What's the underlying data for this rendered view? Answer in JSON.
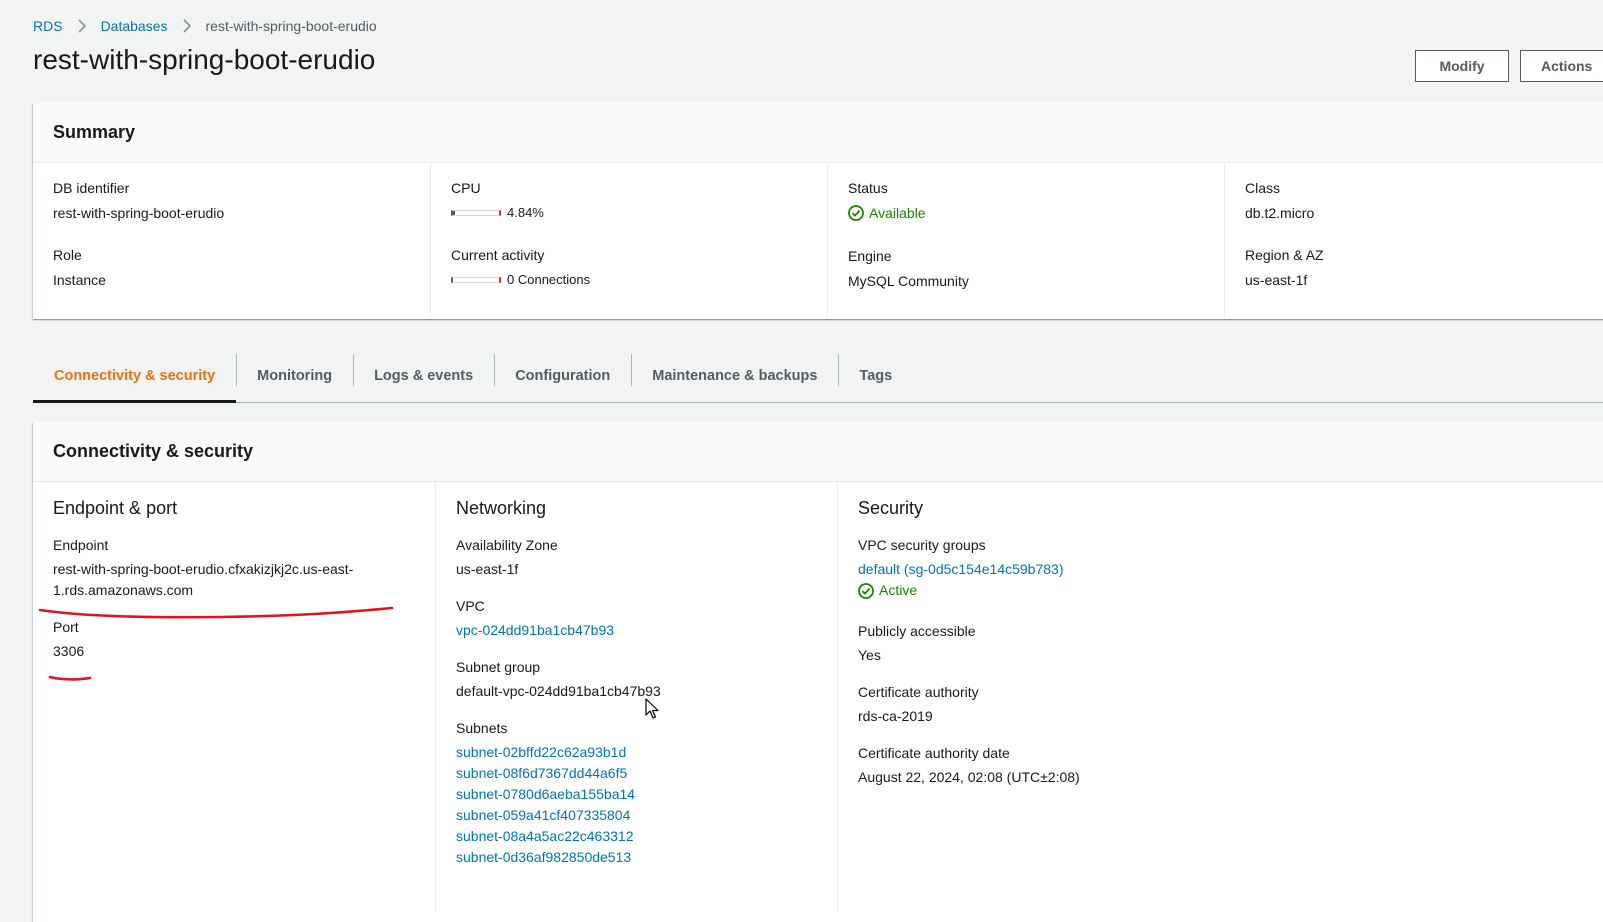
{
  "breadcrumb": {
    "root": "RDS",
    "parent": "Databases",
    "current": "rest-with-spring-boot-erudio"
  },
  "page": {
    "title": "rest-with-spring-boot-erudio"
  },
  "buttons": {
    "modify": "Modify",
    "actions": "Actions"
  },
  "summary": {
    "title": "Summary",
    "db_identifier_label": "DB identifier",
    "db_identifier": "rest-with-spring-boot-erudio",
    "role_label": "Role",
    "role": "Instance",
    "cpu_label": "CPU",
    "cpu_value": "4.84%",
    "cpu_fraction": 0.0484,
    "activity_label": "Current activity",
    "activity_value": "0 Connections",
    "activity_fraction": 0,
    "status_label": "Status",
    "status": "Available",
    "engine_label": "Engine",
    "engine": "MySQL Community",
    "class_label": "Class",
    "class": "db.t2.micro",
    "region_label": "Region & AZ",
    "region": "us-east-1f"
  },
  "tabs": [
    "Connectivity & security",
    "Monitoring",
    "Logs & events",
    "Configuration",
    "Maintenance & backups",
    "Tags"
  ],
  "connectivity": {
    "title": "Connectivity & security",
    "endpoint_section": {
      "heading": "Endpoint & port",
      "endpoint_label": "Endpoint",
      "endpoint_line1": "rest-with-spring-boot-erudio.cfxakizjkj2c.us-east-",
      "endpoint_line2": "1.rds.amazonaws.com",
      "port_label": "Port",
      "port": "3306"
    },
    "networking": {
      "heading": "Networking",
      "az_label": "Availability Zone",
      "az": "us-east-1f",
      "vpc_label": "VPC",
      "vpc": "vpc-024dd91ba1cb47b93",
      "subnet_group_label": "Subnet group",
      "subnet_group": "default-vpc-024dd91ba1cb47b93",
      "subnets_label": "Subnets",
      "subnets": [
        "subnet-02bffd22c62a93b1d",
        "subnet-08f6d7367dd44a6f5",
        "subnet-0780d6aeba155ba14",
        "subnet-059a41cf407335804",
        "subnet-08a4a5ac22c463312",
        "subnet-0d36af982850de513"
      ]
    },
    "security": {
      "heading": "Security",
      "sg_label": "VPC security groups",
      "sg": "default (sg-0d5c154e14c59b783)",
      "sg_status": "Active",
      "public_label": "Publicly accessible",
      "public": "Yes",
      "ca_label": "Certificate authority",
      "ca": "rds-ca-2019",
      "ca_date_label": "Certificate authority date",
      "ca_date": "August 22, 2024, 02:08 (UTC±2:08)"
    }
  },
  "colors": {
    "link": "#0073bb",
    "active_tab": "#ec7211",
    "success": "#1d8102",
    "annotation": "#e0141e"
  }
}
